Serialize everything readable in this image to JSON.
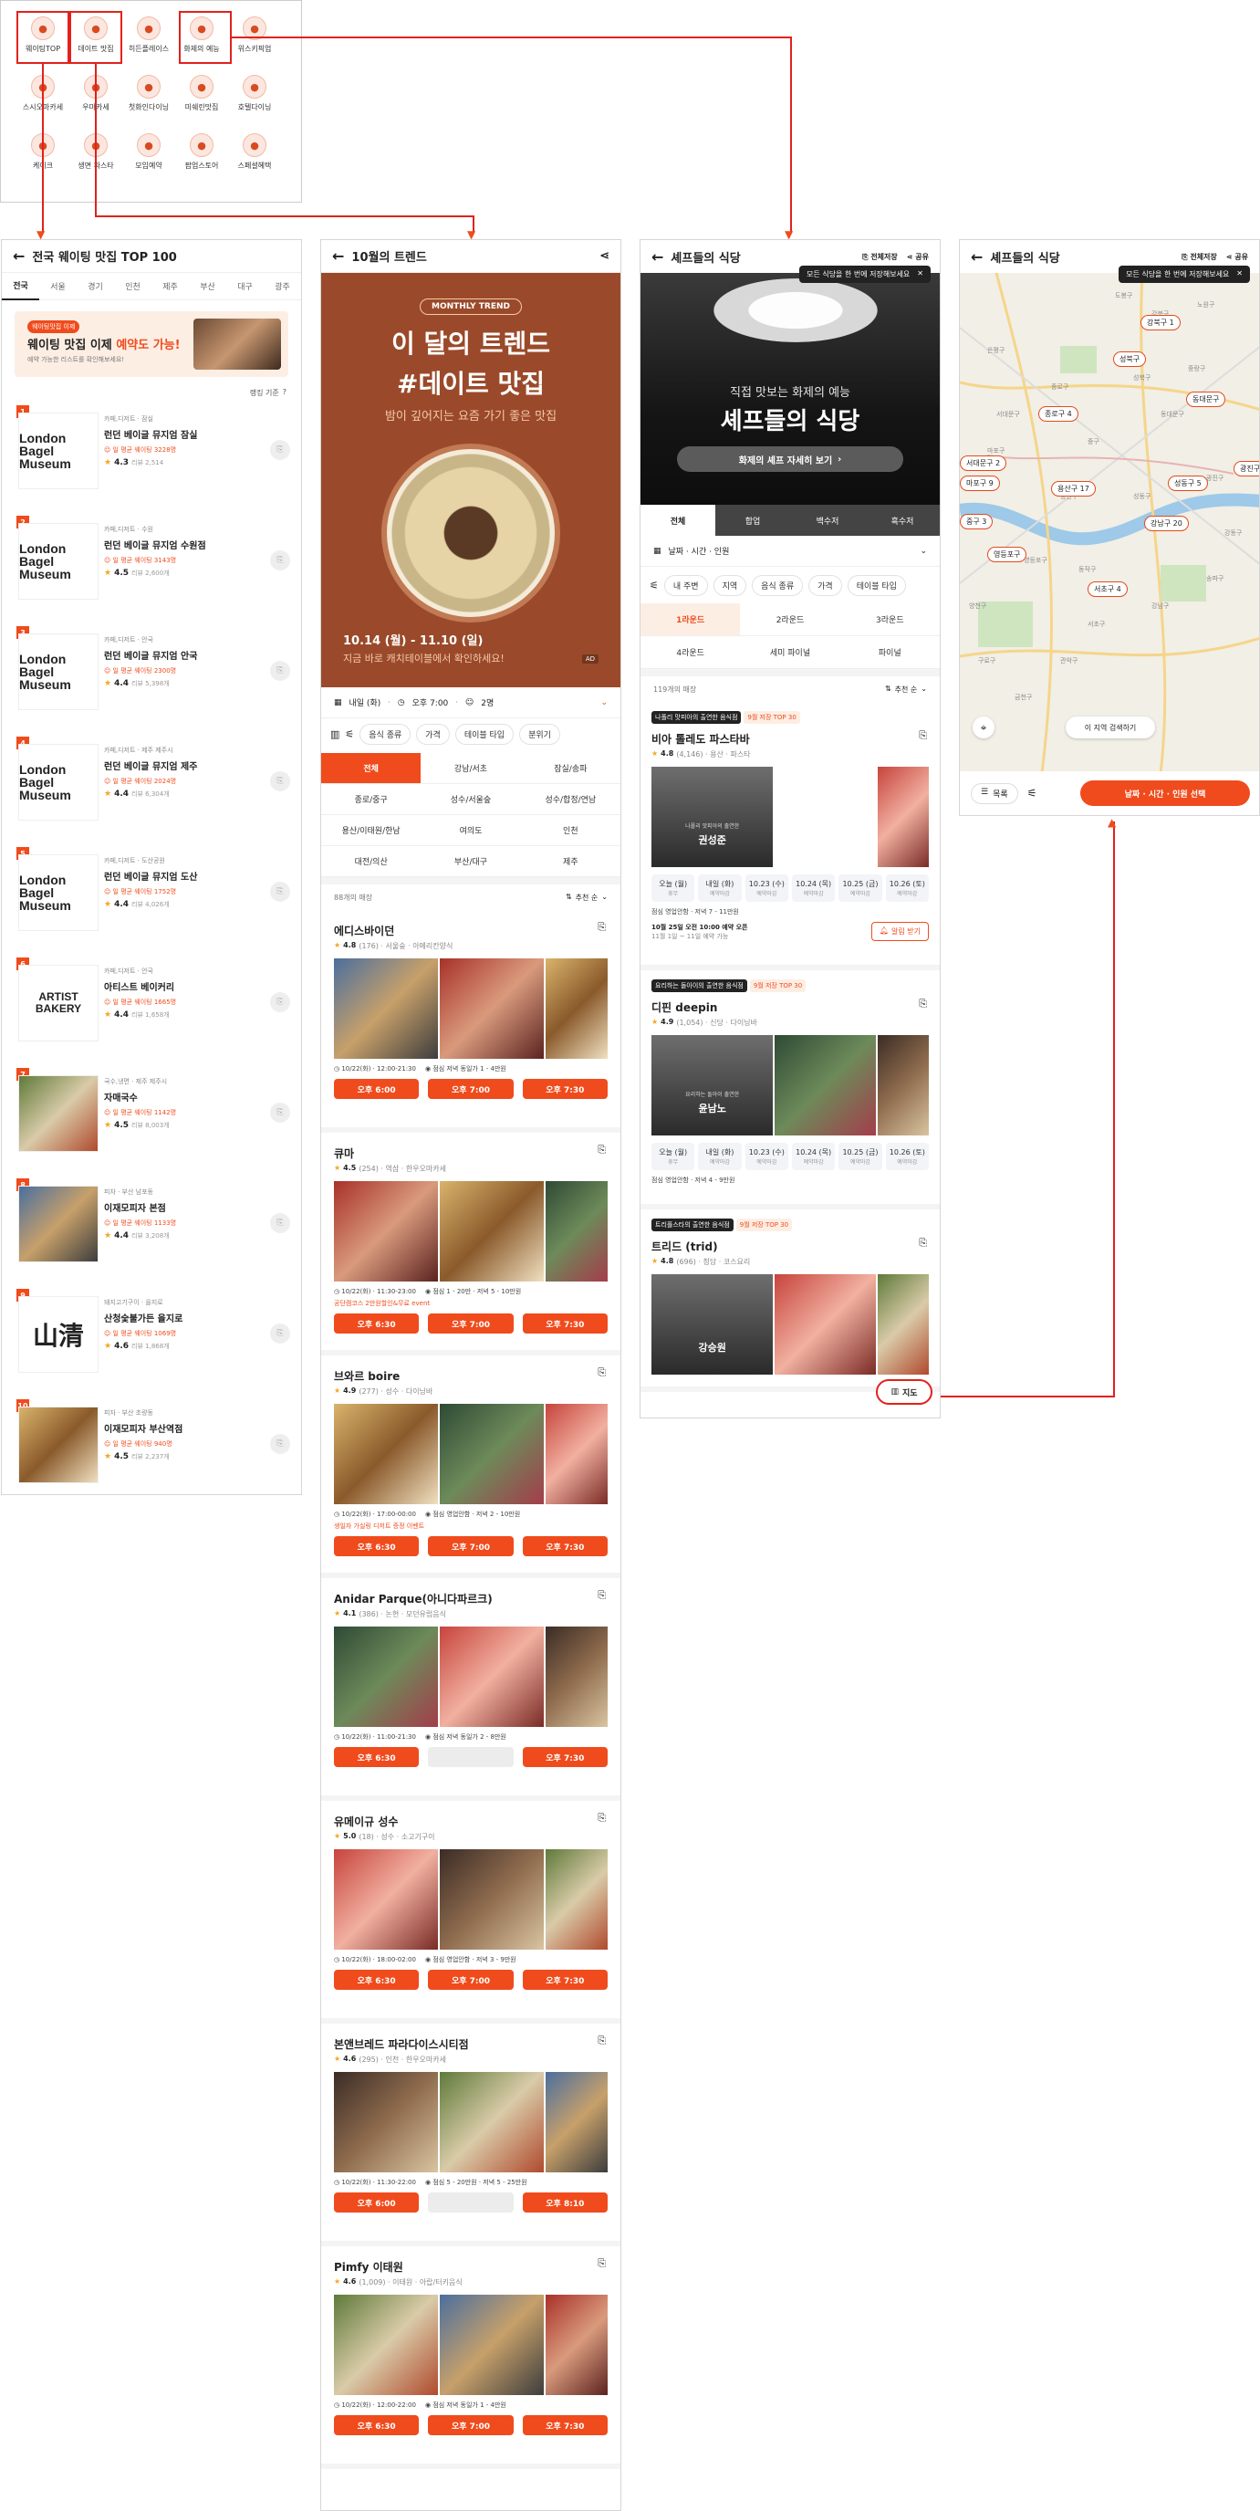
{
  "colors": {
    "accent": "#f04b1c",
    "annotation": "#e2211c",
    "trend_bg": "#9a4a2a"
  },
  "category_menu": {
    "items": [
      {
        "label": "웨이팅TOP",
        "icon": "medal-icon"
      },
      {
        "label": "데이트 맛집",
        "icon": "date-icon"
      },
      {
        "label": "히든플레이스",
        "icon": "magnifier-icon"
      },
      {
        "label": "화제의 예능",
        "icon": "tv-show-icon"
      },
      {
        "label": "위스키픽업",
        "icon": "whisky-icon"
      },
      {
        "label": "스시오마카세",
        "icon": "sushi-icon"
      },
      {
        "label": "우마카세",
        "icon": "beef-icon"
      },
      {
        "label": "첫화인다이닝",
        "icon": "fine-dining-icon"
      },
      {
        "label": "미쉐린맛집",
        "icon": "michelin-icon"
      },
      {
        "label": "호텔다이닝",
        "icon": "hotel-icon"
      },
      {
        "label": "케이크",
        "icon": "cake-icon"
      },
      {
        "label": "생면 파스타",
        "icon": "pasta-icon"
      },
      {
        "label": "모임예약",
        "icon": "group-icon"
      },
      {
        "label": "팝업스토어",
        "icon": "popup-icon"
      },
      {
        "label": "스페셜혜택",
        "icon": "gift-icon"
      }
    ]
  },
  "waiting": {
    "title": "전국 웨이팅 맛집 TOP 100",
    "tabs": [
      "전국",
      "서울",
      "경기",
      "인천",
      "제주",
      "부산",
      "대구",
      "광주"
    ],
    "banner_tag": "웨이팅맛집 이제",
    "banner_title_a": "웨이팅 맛집 이제 ",
    "banner_title_b": "예약도 가능!",
    "banner_sub": "예약 가능한 리스트를 확인해보세요!",
    "sort_label": "랭킹 기준",
    "items": [
      {
        "rank": "1",
        "cat": "카페,디저트 · 잠실",
        "name": "런던 베이글 뮤지엄 잠실",
        "wait": "일 평균 웨이팅 3228명",
        "rating": "4.3",
        "count": "리뷰 2,514",
        "logo": "London Bagel Museum"
      },
      {
        "rank": "2",
        "cat": "카페,디저트 · 수원",
        "name": "런던 베이글 뮤지엄 수원점",
        "wait": "일 평균 웨이팅 3143명",
        "rating": "4.5",
        "count": "리뷰 2,600개",
        "logo": "London Bagel Museum"
      },
      {
        "rank": "3",
        "cat": "카페,디저트 · 안국",
        "name": "런던 베이글 뮤지엄 안국",
        "wait": "일 평균 웨이팅 2300명",
        "rating": "4.4",
        "count": "리뷰 5,398개",
        "logo": "London Bagel Museum"
      },
      {
        "rank": "4",
        "cat": "카페,디저트 · 제주 제주시",
        "name": "런던 베이글 뮤지엄 제주",
        "wait": "일 평균 웨이팅 2024명",
        "rating": "4.4",
        "count": "리뷰 6,304개",
        "logo": "London Bagel Museum"
      },
      {
        "rank": "5",
        "cat": "카페,디저트 · 도산공원",
        "name": "런던 베이글 뮤지엄 도산",
        "wait": "일 평균 웨이팅 1752명",
        "rating": "4.4",
        "count": "리뷰 4,026개",
        "logo": "London Bagel Museum"
      },
      {
        "rank": "6",
        "cat": "카페,디저트 · 안국",
        "name": "아티스트 베이커리",
        "wait": "일 평균 웨이팅 1665명",
        "rating": "4.4",
        "count": "리뷰 1,658개",
        "logo": "ARTIST BAKERY"
      },
      {
        "rank": "7",
        "cat": "국수,냉면 · 제주 제주시",
        "name": "자매국수",
        "wait": "일 평균 웨이팅 1142명",
        "rating": "4.5",
        "count": "리뷰 8,003개",
        "logo": ""
      },
      {
        "rank": "8",
        "cat": "피자 · 부산 남포동",
        "name": "이재모피자 본점",
        "wait": "일 평균 웨이팅 1133명",
        "rating": "4.4",
        "count": "리뷰 3,208개",
        "logo": ""
      },
      {
        "rank": "9",
        "cat": "돼지고기구이 · 을지로",
        "name": "산청숯불가든 을지로",
        "wait": "일 평균 웨이팅 1069명",
        "rating": "4.6",
        "count": "리뷰 1,868개",
        "logo": "山清"
      },
      {
        "rank": "10",
        "cat": "피자 · 부산 초량동",
        "name": "이재모피자 부산역점",
        "wait": "일 평균 웨이팅 940명",
        "rating": "4.5",
        "count": "리뷰 2,237개",
        "logo": ""
      }
    ]
  },
  "trend": {
    "title": "10월의 트렌드",
    "badge": "MONTHLY TREND",
    "headline1": "이 달의 트렌드",
    "headline2": "#데이트 맛집",
    "sub": "밤이 깊어지는 요즘 가기 좋은 맛집",
    "dates": "10.14 (월) - 11.10 (일)",
    "cta": "지금 바로 캐치테이블에서 확인하세요!",
    "ad": "AD",
    "filter_date": "내일 (화)",
    "filter_time": "오후 7:00",
    "filter_people": "2명",
    "chips": [
      "음식 종류",
      "가격",
      "테이블 타입",
      "분위기"
    ],
    "regions": [
      "전체",
      "강남/서초",
      "잠실/송파",
      "종로/중구",
      "성수/서울숲",
      "성수/합정/연남",
      "용산/이태원/한남",
      "여의도",
      "인천",
      "대전/의산",
      "부산/대구",
      "제주"
    ],
    "result_count": "88개의 매장",
    "sort": "추천 순",
    "restaurants": [
      {
        "name": "에디스바이던",
        "rating": "4.8",
        "meta": "(176) · 서울숲 · 아메리칸양식",
        "info1": "10/22(화) · 12:00-21:30",
        "info2": "점심 저녁 동일가 1 - 4만원",
        "badge": "",
        "slots": [
          "오후 6:00",
          "오후 7:00",
          "오후 7:30"
        ]
      },
      {
        "name": "큐마",
        "rating": "4.5",
        "meta": "(254) · 역삼 · 한우오마카세",
        "info1": "10/22(화) · 11:30-23:00",
        "info2": "점심 1 - 20만 · 저녁 5 - 10만원",
        "badge": "공단캠코스 2만원할인&무료 event",
        "slots": [
          "오후 6:30",
          "오후 7:00",
          "오후 7:30"
        ]
      },
      {
        "name": "브와르 boire",
        "rating": "4.9",
        "meta": "(277) · 성수 · 다이닝바",
        "info1": "10/22(화) · 17:00-00:00",
        "info2": "점심 영업안함 · 저녁 2 - 10만원",
        "badge": "생일자 가실링 디저트 증정 이벤트",
        "slots": [
          "오후 6:30",
          "오후 7:00",
          "오후 7:30"
        ]
      },
      {
        "name": "Anidar Parque(아니다파르크)",
        "rating": "4.1",
        "meta": "(386) · 논현 · 모던유럽음식",
        "info1": "10/22(화) · 11:00-21:30",
        "info2": "점심 저녁 동일가 2 - 8만원",
        "badge": "",
        "slots": [
          "오후 6:30",
          "",
          "오후 7:30"
        ]
      },
      {
        "name": "유메이규 성수",
        "rating": "5.0",
        "meta": "(18) · 성수 · 소고기구이",
        "info1": "10/22(화) · 18:00-02:00",
        "info2": "점심 영업안함 · 저녁 3 - 9만원",
        "badge": "",
        "slots": [
          "오후 6:30",
          "오후 7:00",
          "오후 7:30"
        ]
      },
      {
        "name": "본앤브레드 파라다이스시티점",
        "rating": "4.6",
        "meta": "(295) · 인천 · 한우오마카세",
        "info1": "10/22(화) · 11:30-22:00",
        "info2": "점심 5 - 20만원 · 저녁 5 - 25만원",
        "badge": "",
        "slots": [
          "오후 6:00",
          "",
          "오후 8:10"
        ]
      },
      {
        "name": "Pimfy 이태원",
        "rating": "4.6",
        "meta": "(1,009) · 이태원 · 아랍/터키음식",
        "info1": "10/22(화) · 12:00-22:00",
        "info2": "점심 저녁 동일가 1 - 4만원",
        "badge": "",
        "slots": [
          "오후 6:30",
          "오후 7:00",
          "오후 7:30"
        ]
      }
    ]
  },
  "chef": {
    "title": "셰프들의 식당",
    "save_all": "전체저장",
    "share": "공유",
    "tooltip": "모든 식당을 한 번에 저장해보세요",
    "hero_sub": "직접 맛보는 화제의 예능",
    "hero_title": "셰프들의 식당",
    "hero_btn": "화제의 셰프 자세히 보기",
    "tabs": [
      "전체",
      "합업",
      "백수저",
      "흑수저"
    ],
    "filter": "날짜 · 시간 · 인원",
    "chips": [
      "내 주변",
      "지역",
      "음식 종류",
      "가격",
      "테이블 타입"
    ],
    "rounds": [
      "1라운드",
      "2라운드",
      "3라운드",
      "4라운드",
      "세미 파이널",
      "파이널"
    ],
    "result_count": "119개의 매장",
    "sort": "추천 순",
    "restaurants": [
      {
        "tag": "나폴리 맛피아의 출연한 음식점",
        "badge": "9월 저장 TOP 30",
        "name": "비아 톨레도 파스타바",
        "rating": "4.8",
        "meta": "(4,146) · 용산 · 파스타",
        "chef_title": "나폴리 맛피아의 출연한",
        "chef": "권성준",
        "info": "점심 영업안함 · 저녁 7 - 11만원",
        "notice": "10월 25일 오전 10:00 예약 오픈",
        "notice2": "11월 1일 ~ 11일 예약 가능",
        "alert": "알림 받기"
      },
      {
        "tag": "요리하는 돌아이의 출연한 음식점",
        "badge": "9월 저장 TOP 30",
        "name": "디핀 deepin",
        "rating": "4.9",
        "meta": "(1,054) · 신당 · 다이닝바",
        "chef_title": "요리하는 돌아이 출연한",
        "chef": "윤남노",
        "info": "점심 영업안함 · 저녁 4 - 9만원",
        "notice": "",
        "notice2": "",
        "alert": ""
      },
      {
        "tag": "트리플스타의 출연한 음식점",
        "badge": "9월 저장 TOP 30",
        "name": "트리드 (trid)",
        "rating": "4.8",
        "meta": "(696) · 청담 · 코스요리",
        "chef_title": "",
        "chef": "강승원",
        "info": "",
        "notice": "",
        "notice2": "",
        "alert": ""
      }
    ],
    "slots": [
      {
        "d": "오늘 (월)",
        "s": "휴무"
      },
      {
        "d": "내일 (화)",
        "s": "예약마감"
      },
      {
        "d": "10.23 (수)",
        "s": "예약마감"
      },
      {
        "d": "10.24 (목)",
        "s": "예약마감"
      },
      {
        "d": "10.25 (금)",
        "s": "예약마감"
      },
      {
        "d": "10.26 (토)",
        "s": "예약마감"
      }
    ],
    "map_btn": "지도"
  },
  "map": {
    "title": "셰프들의 식당",
    "save_all": "전체저장",
    "share": "공유",
    "tooltip": "모든 식당을 한 번에 저장해보세요",
    "pins": [
      "강북구 1",
      "종로구 4",
      "서대문구 2",
      "마포구 9",
      "용산구 17",
      "중구 3",
      "성동구 5",
      "강남구 20",
      "서초구 4",
      "광진구",
      "동대문구",
      "성북구",
      "영등포구"
    ],
    "search_here": "이 지역 검색하기",
    "list_btn": "목록",
    "select_btn": "날짜 · 시간 · 인원 선택",
    "districts": [
      "도봉구",
      "강북구",
      "노원구",
      "은평구",
      "성북구",
      "중랑구",
      "종로구",
      "동대문구",
      "서대문구",
      "마포구",
      "중구",
      "성동구",
      "광진구",
      "용산구",
      "강서구",
      "영등포구",
      "동작구",
      "서초구",
      "강남구",
      "송파구",
      "강동구",
      "관악구",
      "금천구",
      "구로구",
      "양천구"
    ]
  }
}
